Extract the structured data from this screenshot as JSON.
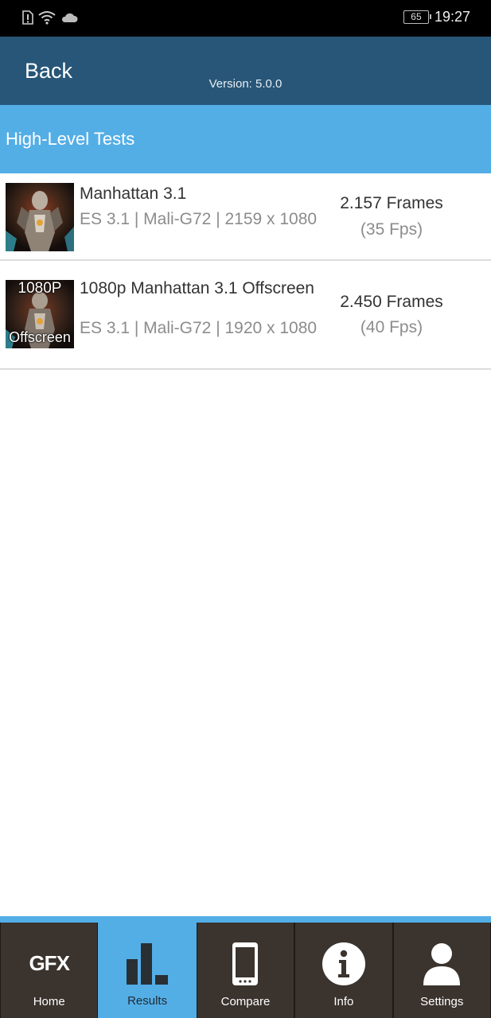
{
  "status_bar": {
    "battery": "65",
    "time": "19:27"
  },
  "header": {
    "back_label": "Back",
    "version": "Version: 5.0.0"
  },
  "section": {
    "title": "High-Level Tests"
  },
  "results": [
    {
      "thumb_top": "",
      "thumb_bottom": "",
      "name": "Manhattan 3.1",
      "detail": "ES 3.1 | Mali-G72 | 2159 x 1080",
      "score": "2.157 Frames",
      "fps": "(35 Fps)"
    },
    {
      "thumb_top": "1080P",
      "thumb_bottom": "Offscreen",
      "name": "1080p Manhattan 3.1 Offscreen",
      "detail": "ES 3.1 | Mali-G72 | 1920 x 1080",
      "score": "2.450 Frames",
      "fps": "(40 Fps)"
    }
  ],
  "nav": {
    "home": "Home",
    "home_logo": "GFX",
    "results": "Results",
    "compare": "Compare",
    "info": "Info",
    "settings": "Settings",
    "active": "Results"
  },
  "colors": {
    "header_bg": "#275678",
    "accent": "#54aee6",
    "nav_bg": "#3a332e"
  }
}
